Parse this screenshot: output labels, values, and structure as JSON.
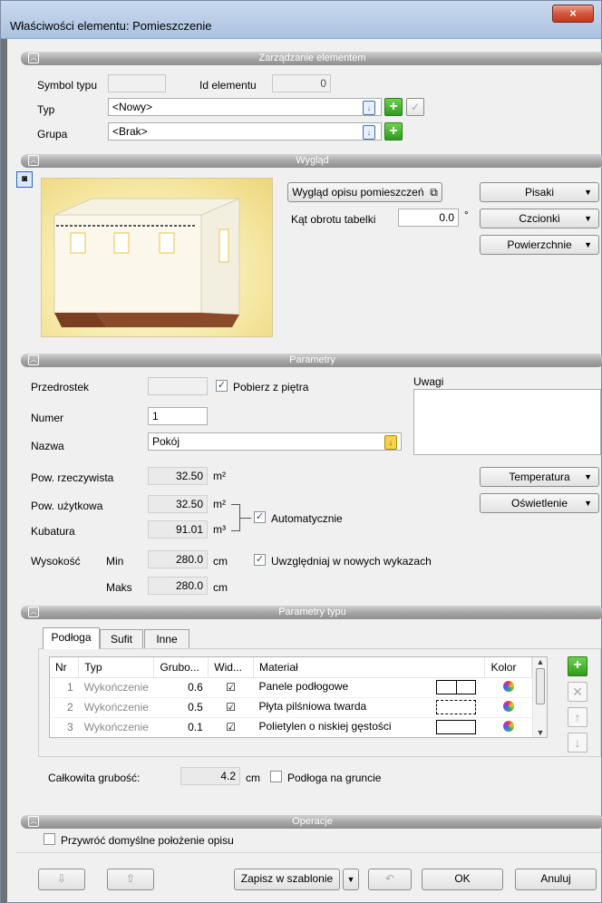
{
  "window": {
    "title": "Właściwości elementu: Pomieszczenie",
    "close_icon": "×"
  },
  "sections": {
    "zarzadzanie": "Zarządzanie elementem",
    "wyglad": "Wygląd",
    "parametry": "Parametry",
    "parametry_typu": "Parametry typu",
    "operacje": "Operacje"
  },
  "management": {
    "symbol_typu_label": "Symbol typu",
    "symbol_typu_value": "",
    "id_label": "Id elementu",
    "id_value": "0",
    "typ_label": "Typ",
    "typ_value": "<Nowy>",
    "grupa_label": "Grupa",
    "grupa_value": "<Brak>"
  },
  "appearance": {
    "opis_button": "Wygląd opisu pomieszczeń",
    "kat_label": "Kąt obrotu tabelki",
    "kat_value": "0.0",
    "kat_unit": "°",
    "pisaki": "Pisaki",
    "czcionki": "Czcionki",
    "powierzchnie": "Powierzchnie"
  },
  "params": {
    "przedrostek_label": "Przedrostek",
    "przedrostek_value": "",
    "pobierz_label": "Pobierz z piętra",
    "pobierz_checked": true,
    "uwagi_label": "Uwagi",
    "numer_label": "Numer",
    "numer_value": "1",
    "nazwa_label": "Nazwa",
    "nazwa_value": "Pokój",
    "pow_rz_label": "Pow. rzeczywista",
    "pow_rz_value": "32.50",
    "pow_uz_label": "Pow. użytkowa",
    "pow_uz_value": "32.50",
    "kubatura_label": "Kubatura",
    "kubatura_value": "91.01",
    "unit_m2": "m²",
    "unit_m3": "m³",
    "automatycznie_label": "Automatycznie",
    "wysokosc_label": "Wysokość",
    "min_label": "Min",
    "min_value": "280.0",
    "maks_label": "Maks",
    "maks_value": "280.0",
    "unit_cm": "cm",
    "uwzgledniaj_label": "Uwzględniaj w nowych wykazach",
    "temperatura": "Temperatura",
    "oswietlenie": "Oświetlenie"
  },
  "type_params": {
    "tabs": [
      "Podłoga",
      "Sufit",
      "Inne"
    ],
    "columns": [
      "Nr",
      "Typ",
      "Grubo...",
      "Wid...",
      "Materiał",
      "Kolor"
    ],
    "rows": [
      {
        "nr": "1",
        "typ": "Wykończenie",
        "grubosc": "0.6",
        "visible": "☑",
        "material": "Panele podłogowe"
      },
      {
        "nr": "2",
        "typ": "Wykończenie",
        "grubosc": "0.5",
        "visible": "☑",
        "material": "Płyta pilśniowa twarda"
      },
      {
        "nr": "3",
        "typ": "Wykończenie",
        "grubosc": "0.1",
        "visible": "☑",
        "material": "Polietylen o niskiej gęstości"
      }
    ],
    "total_label": "Całkowita grubość:",
    "total_value": "4.2",
    "total_unit": "cm",
    "grunt_label": "Podłoga na gruncie"
  },
  "operations": {
    "przywroc_label": "Przywróć domyślne położenie opisu"
  },
  "footer": {
    "zapisz": "Zapisz w szablonie",
    "ok": "OK",
    "anuluj": "Anuluj"
  },
  "colors": {
    "accent_blue": "#3b6fb0",
    "green_plus": "#2f9a1c",
    "section_gray": "#a4a4a4"
  }
}
